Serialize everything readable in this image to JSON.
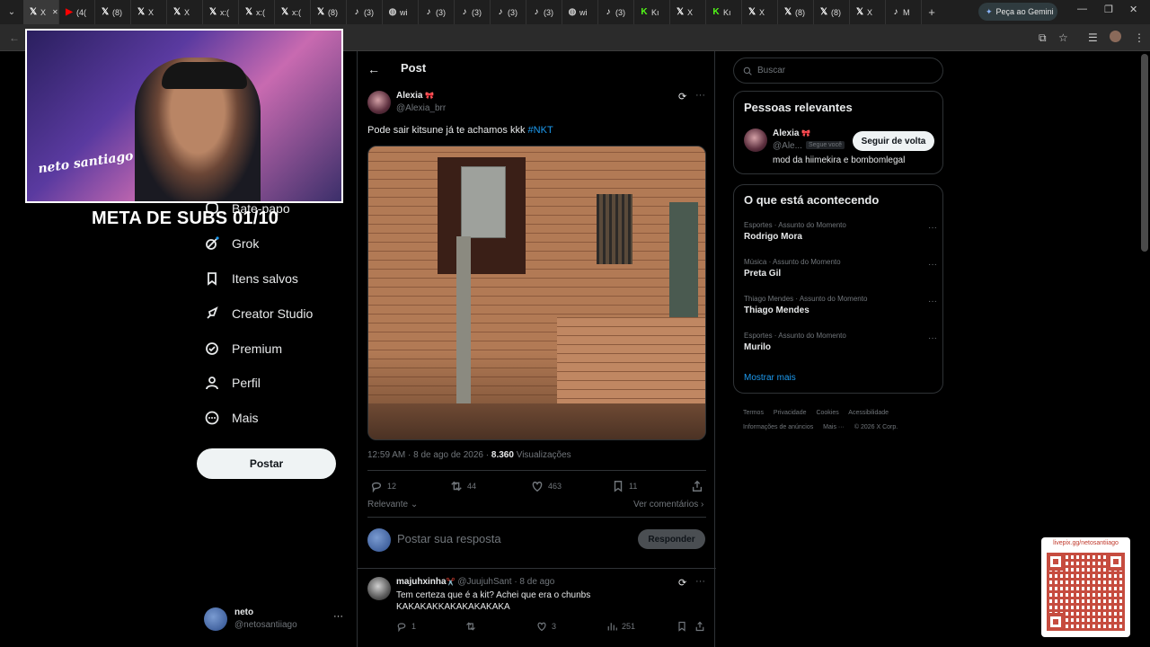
{
  "browser": {
    "tabs": [
      {
        "icon": "x-icon",
        "label": "X",
        "active": true
      },
      {
        "icon": "youtube-icon",
        "label": "(4("
      },
      {
        "icon": "x-icon",
        "label": "(8)"
      },
      {
        "icon": "x-icon",
        "label": "X"
      },
      {
        "icon": "x-icon",
        "label": "X"
      },
      {
        "icon": "x-icon",
        "label": "x:("
      },
      {
        "icon": "x-icon",
        "label": "x:("
      },
      {
        "icon": "x-icon",
        "label": "x:("
      },
      {
        "icon": "x-icon",
        "label": "(8)"
      },
      {
        "icon": "tiktok-icon",
        "label": "(3)"
      },
      {
        "icon": "globe-icon",
        "label": "wi"
      },
      {
        "icon": "tiktok-icon",
        "label": "(3)"
      },
      {
        "icon": "tiktok-icon",
        "label": "(3)"
      },
      {
        "icon": "tiktok-icon",
        "label": "(3)"
      },
      {
        "icon": "tiktok-icon",
        "label": "(3)"
      },
      {
        "icon": "globe-icon",
        "label": "wi"
      },
      {
        "icon": "tiktok-icon",
        "label": "(3)"
      },
      {
        "icon": "kick-icon",
        "label": "Kı"
      },
      {
        "icon": "x-icon",
        "label": "X"
      },
      {
        "icon": "kick-icon",
        "label": "Kı"
      },
      {
        "icon": "x-icon",
        "label": "X"
      },
      {
        "icon": "x-icon",
        "label": "(8)"
      },
      {
        "icon": "x-icon",
        "label": "(8)"
      },
      {
        "icon": "x-icon",
        "label": "X"
      },
      {
        "icon": "tiktok-icon",
        "label": "M"
      }
    ],
    "gemini_label": "Peça ao Gemini"
  },
  "overlay": {
    "stream_goal": "META DE SUBS 01/10",
    "cam_logo": "neto santiago"
  },
  "nav": {
    "items": [
      {
        "icon": "chat-icon",
        "label": "Bate-papo"
      },
      {
        "icon": "grok-icon",
        "label": "Grok"
      },
      {
        "icon": "bookmark-icon",
        "label": "Itens salvos"
      },
      {
        "icon": "rocket-icon",
        "label": "Creator Studio"
      },
      {
        "icon": "verified-icon",
        "label": "Premium"
      },
      {
        "icon": "person-icon",
        "label": "Perfil"
      },
      {
        "icon": "more-circle-icon",
        "label": "Mais"
      }
    ],
    "post_button": "Postar",
    "account": {
      "name": "neto",
      "handle": "@netosantiiago"
    }
  },
  "post": {
    "header_title": "Post",
    "author_name": "Alexia",
    "author_badge": "🎀",
    "author_handle": "@Alexia_brr",
    "text": "Pode sair kitsune já te achamos kkk",
    "hashtag": "#NKT",
    "time": "12:59 AM · 8 de ago de 2026 ·",
    "views_count": "8.360",
    "views_label": "Visualizações",
    "replies": "12",
    "reposts": "44",
    "likes": "463",
    "bookmarks": "11",
    "sort_label": "Relevante",
    "see_comments": "Ver comentários",
    "reply_placeholder": "Postar sua resposta",
    "reply_button": "Responder"
  },
  "comment": {
    "name": "majuhxinha",
    "name_badge": "✂️",
    "handle": "@JuujuhSant",
    "date": "· 8 de ago",
    "text": "Tem certeza que é a kit? Achei que era o chunbs KAKAKAKKAKAKAKAKAKA",
    "replies": "1",
    "reposts": "",
    "likes": "3",
    "views": "251"
  },
  "sidebar": {
    "search_placeholder": "Buscar",
    "relevant_title": "Pessoas relevantes",
    "relevant_person": {
      "name": "Alexia",
      "badge": "🎀",
      "handle": "@Ale...",
      "follows_you": "Segue você",
      "follow_button": "Seguir de volta",
      "bio": "mod da hiimekira e bombomlegal"
    },
    "trending_title": "O que está acontecendo",
    "trends": [
      {
        "category": "Esportes · Assunto do Momento",
        "name": "Rodrigo Mora"
      },
      {
        "category": "Música · Assunto do Momento",
        "name": "Preta Gil"
      },
      {
        "category": "Thiago Mendes · Assunto do Momento",
        "name": "Thiago Mendes"
      },
      {
        "category": "Esportes · Assunto do Momento",
        "name": "Murilo"
      }
    ],
    "show_more": "Mostrar mais",
    "footer": [
      "Termos",
      "Privacidade",
      "Cookies",
      "Acessibilidade",
      "Informações de anúncios",
      "Mais ···",
      "© 2026 X Corp."
    ]
  },
  "qr": {
    "url": "livepix.gg/netosantiiago"
  },
  "colors": {
    "accent": "#1d9bf0",
    "background": "#000000",
    "border": "#2f3336",
    "muted": "#71767b"
  }
}
